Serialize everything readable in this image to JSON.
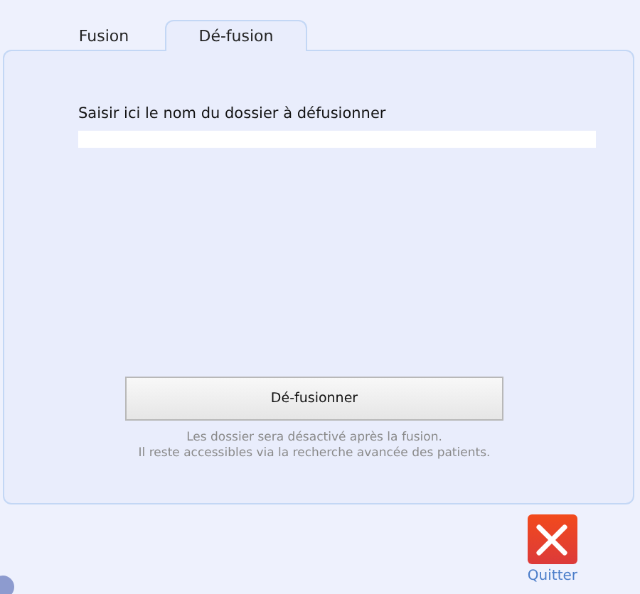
{
  "tabs": [
    {
      "label": "Fusion",
      "selected": false
    },
    {
      "label": "Dé-fusion",
      "selected": true
    }
  ],
  "folder_field": {
    "label": "Saisir ici le nom du dossier à défusionner"
  },
  "action_button": "Dé-fusionner",
  "notes": [
    "Les dossier sera désactivé après la fusion.",
    "Il reste accessibles via la recherche avancée des patients."
  ],
  "quit": {
    "label": "Quitter"
  }
}
